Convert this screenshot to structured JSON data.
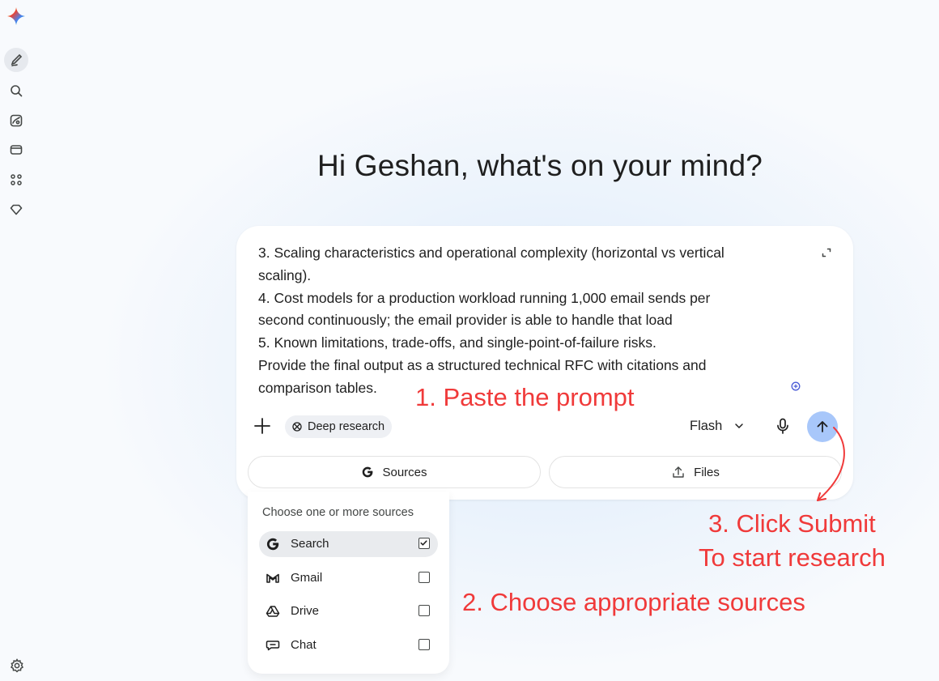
{
  "sidebar": {
    "logo": "gemini-sparkle-icon",
    "items": [
      {
        "name": "new-chat",
        "icon": "edit-icon",
        "active": true
      },
      {
        "name": "search",
        "icon": "search-icon"
      },
      {
        "name": "gems",
        "icon": "gem-image-icon"
      },
      {
        "name": "library",
        "icon": "folder-icon"
      },
      {
        "name": "apps",
        "icon": "apps-icon"
      },
      {
        "name": "upgrade",
        "icon": "diamond-icon"
      }
    ],
    "footer_icon": "settings-icon"
  },
  "greeting": "Hi Geshan, what's on your mind?",
  "composer": {
    "prompt_lines": [
      "3. Scaling characteristics and operational complexity (horizontal vs vertical",
      "scaling).",
      "4. Cost models for a production workload running 1,000 email sends per",
      "second continuously; the email provider is able to handle that load",
      "5. Known limitations, trade-offs, and single-point-of-failure risks.",
      "Provide the final output as a structured technical RFC with citations and",
      "comparison tables."
    ],
    "tool_chip_label": "Deep research",
    "model_label": "Flash",
    "sources_button_label": "Sources",
    "files_button_label": "Files"
  },
  "sources_menu": {
    "header": "Choose one or more sources",
    "options": [
      {
        "label": "Search",
        "icon": "google-g-icon",
        "checked": true
      },
      {
        "label": "Gmail",
        "icon": "gmail-icon",
        "checked": false
      },
      {
        "label": "Drive",
        "icon": "drive-icon",
        "checked": false
      },
      {
        "label": "Chat",
        "icon": "chat-icon",
        "checked": false
      }
    ]
  },
  "annotations": {
    "step1": "1. Paste the prompt",
    "step2": "2. Choose appropriate sources",
    "step3_line1": "3. Click Submit",
    "step3_line2": "To start research"
  },
  "colors": {
    "send_button": "#a8c7fa",
    "annotation": "#f03a3a",
    "chip_bg": "#eef0f4"
  }
}
